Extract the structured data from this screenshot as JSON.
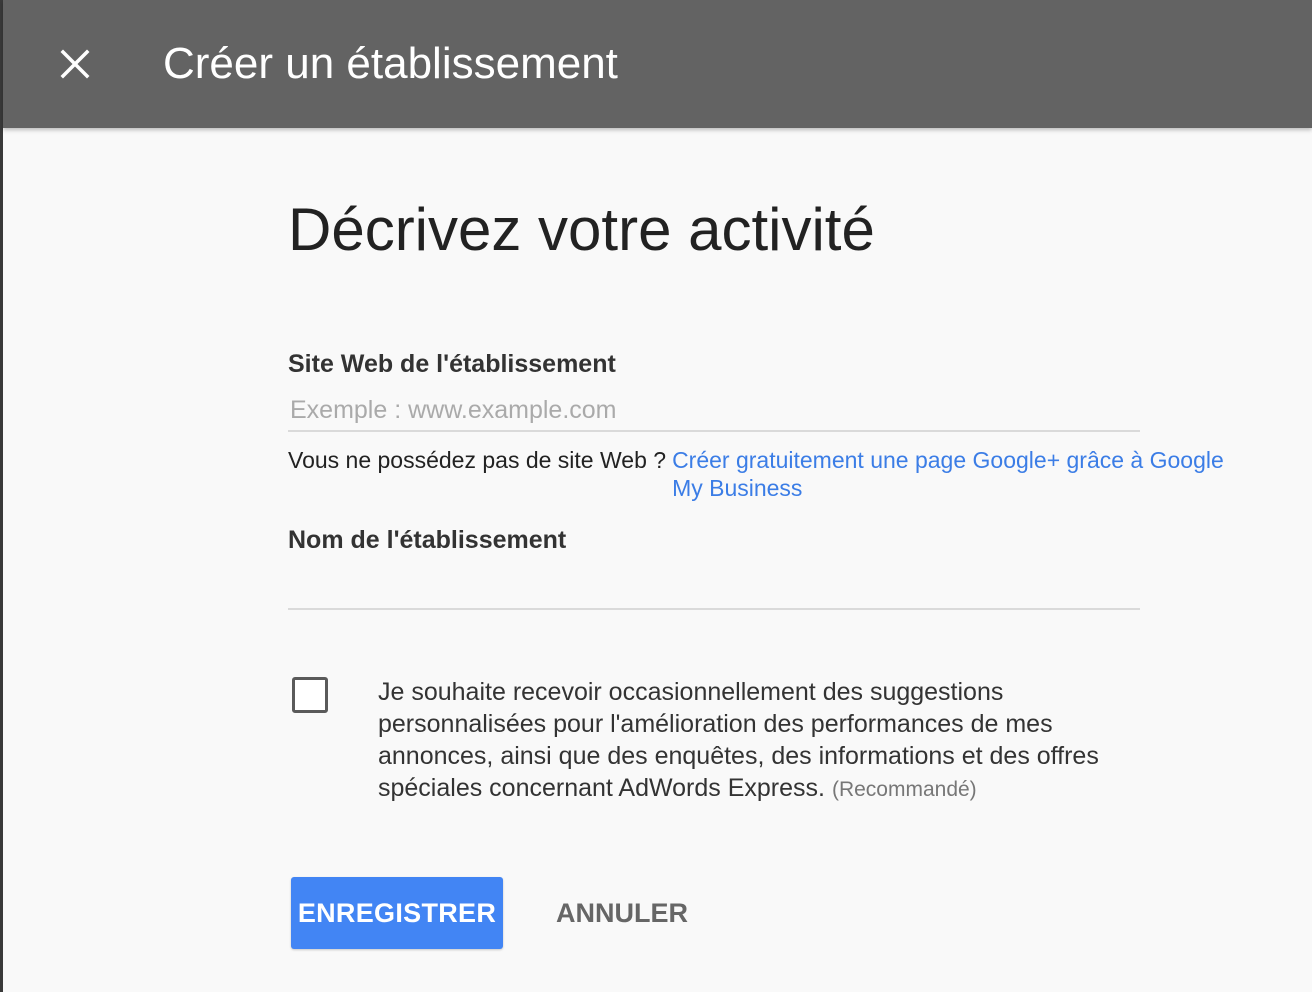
{
  "header": {
    "title": "Créer un établissement",
    "close_icon": "close-icon",
    "background_color": "#636363"
  },
  "main": {
    "heading": "Décrivez votre activité",
    "website_field": {
      "label": "Site Web de l'établissement",
      "placeholder": "Exemple : www.example.com",
      "value": ""
    },
    "website_hint": {
      "text": "Vous ne possédez pas de site Web ?",
      "link_text": "Créer gratuitement une page Google+ grâce à Google My Business",
      "link_color": "#3b7de6"
    },
    "name_field": {
      "label": "Nom de l'établissement",
      "placeholder": "",
      "value": ""
    },
    "consent": {
      "checked": false,
      "text": "Je souhaite recevoir occasionnellement des suggestions personnalisées pour l'amélioration des performances de mes annonces, ainsi que des enquêtes, des informations et des offres spéciales concernant AdWords Express.",
      "note": "(Recommandé)"
    },
    "actions": {
      "save_label": "ENREGISTRER",
      "cancel_label": "ANNULER",
      "save_color": "#4285f4"
    }
  }
}
